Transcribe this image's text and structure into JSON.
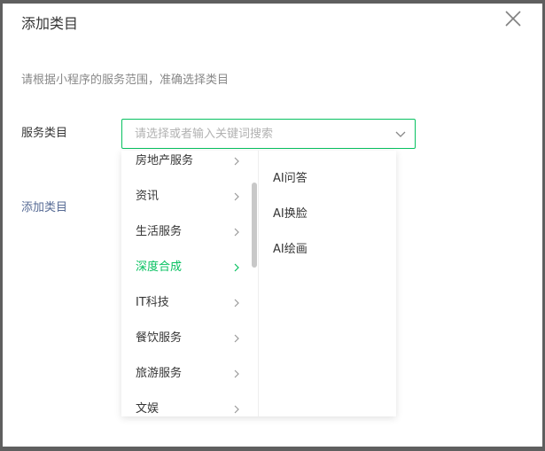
{
  "dialog": {
    "title": "添加类目",
    "hint": "请根据小程序的服务范围，准确选择类目",
    "field_label": "服务类目",
    "add_link": "添加类目"
  },
  "select": {
    "placeholder": "请选择或者输入关键词搜索",
    "value": ""
  },
  "categories": [
    {
      "label": "房地产服务",
      "active": false
    },
    {
      "label": "资讯",
      "active": false
    },
    {
      "label": "生活服务",
      "active": false
    },
    {
      "label": "深度合成",
      "active": true
    },
    {
      "label": "IT科技",
      "active": false
    },
    {
      "label": "餐饮服务",
      "active": false
    },
    {
      "label": "旅游服务",
      "active": false
    },
    {
      "label": "文娱",
      "active": false
    }
  ],
  "subcategories": [
    {
      "label": "AI问答"
    },
    {
      "label": "AI换脸"
    },
    {
      "label": "AI绘画"
    }
  ],
  "colors": {
    "accent": "#07c160",
    "link": "#576b95"
  }
}
